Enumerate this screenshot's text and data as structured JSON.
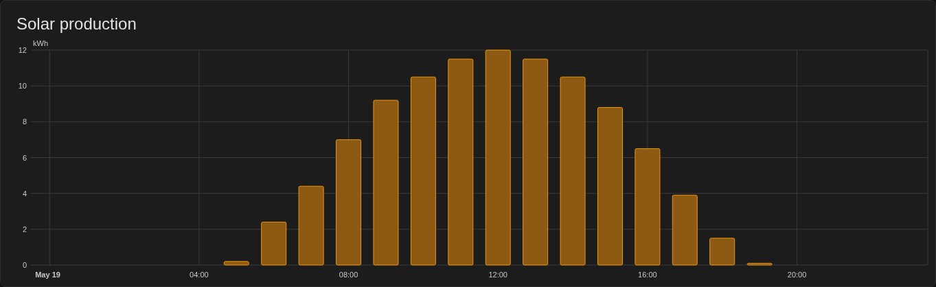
{
  "card": {
    "title": "Solar production",
    "chart_data": {
      "type": "bar",
      "ylabel": "kWh",
      "x": [
        5,
        6,
        7,
        8,
        9,
        10,
        11,
        12,
        13,
        14,
        15,
        16,
        17,
        18,
        19
      ],
      "values": [
        0.2,
        2.4,
        4.4,
        7.0,
        9.2,
        10.5,
        11.5,
        12.0,
        11.5,
        10.5,
        8.8,
        6.5,
        3.9,
        1.5,
        0.1
      ],
      "xlim": [
        -0.5,
        23.5
      ],
      "ylim": [
        0,
        12
      ],
      "xticks": [
        {
          "value": 0,
          "label": "May 19"
        },
        {
          "value": 4,
          "label": "04:00"
        },
        {
          "value": 8,
          "label": "08:00"
        },
        {
          "value": 12,
          "label": "12:00"
        },
        {
          "value": 16,
          "label": "16:00"
        },
        {
          "value": 20,
          "label": "20:00"
        }
      ],
      "yticks": [
        0,
        2,
        4,
        6,
        8,
        10,
        12
      ],
      "grid": true
    }
  }
}
